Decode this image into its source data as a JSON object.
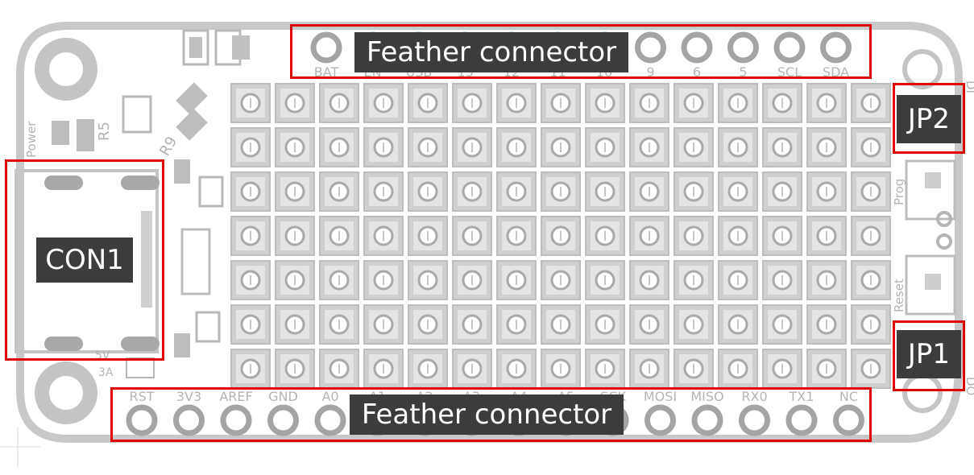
{
  "callouts": {
    "top_connector": "Feather connector",
    "bottom_connector": "Feather connector",
    "con1": "CON1",
    "jp2": "JP2",
    "jp1": "JP1"
  },
  "silkscreen": {
    "top_pins": [
      "BAT",
      "EN",
      "USB",
      "13",
      "12",
      "11",
      "10",
      "9",
      "6",
      "5",
      "SCL",
      "SDA"
    ],
    "bottom_pins": [
      "RST",
      "3V3",
      "AREF",
      "GND",
      "A0",
      "A1",
      "A2",
      "A3",
      "A4",
      "A5",
      "SCK",
      "MOSI",
      "MISO",
      "RX0",
      "TX1",
      "NC"
    ],
    "side_labels": {
      "power": "Power",
      "r5": "R5",
      "r9": "R9",
      "prog": "Prog",
      "reset": "Reset",
      "v5": "5V",
      "a3": "3A",
      "di": "DI",
      "do": "DO"
    }
  },
  "led_matrix": {
    "rows": 7,
    "cols": 15
  },
  "colors": {
    "board_fill": "#ffffff",
    "board_outline": "#c8c8c8",
    "copper": "#c0c0c0",
    "silkscreen": "#b4b4b4",
    "pad_dark": "#9a9a9a",
    "callout_bg": "#3c3c3c",
    "callout_text": "#ffffff",
    "highlight": "#e00000"
  }
}
